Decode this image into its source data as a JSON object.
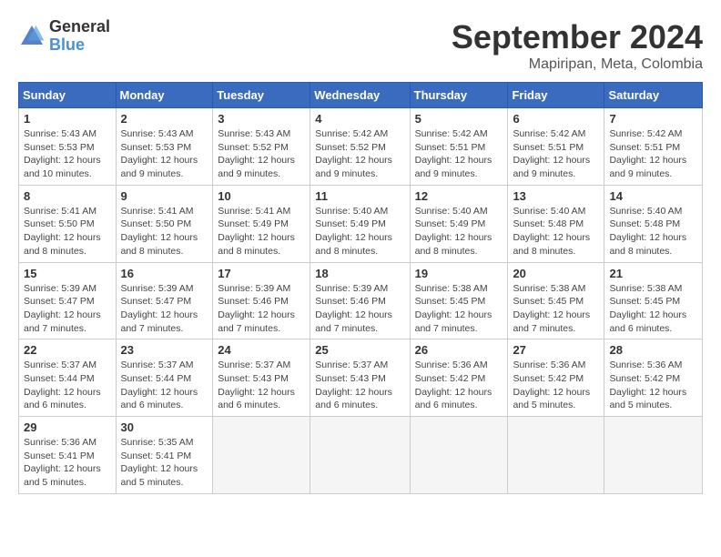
{
  "logo": {
    "text1": "General",
    "text2": "Blue"
  },
  "title": {
    "month_year": "September 2024",
    "location": "Mapiripan, Meta, Colombia"
  },
  "days_of_week": [
    "Sunday",
    "Monday",
    "Tuesday",
    "Wednesday",
    "Thursday",
    "Friday",
    "Saturday"
  ],
  "weeks": [
    [
      {
        "day": "1",
        "sunrise": "5:43 AM",
        "sunset": "5:53 PM",
        "daylight": "12 hours and 10 minutes."
      },
      {
        "day": "2",
        "sunrise": "5:43 AM",
        "sunset": "5:53 PM",
        "daylight": "12 hours and 9 minutes."
      },
      {
        "day": "3",
        "sunrise": "5:43 AM",
        "sunset": "5:52 PM",
        "daylight": "12 hours and 9 minutes."
      },
      {
        "day": "4",
        "sunrise": "5:42 AM",
        "sunset": "5:52 PM",
        "daylight": "12 hours and 9 minutes."
      },
      {
        "day": "5",
        "sunrise": "5:42 AM",
        "sunset": "5:51 PM",
        "daylight": "12 hours and 9 minutes."
      },
      {
        "day": "6",
        "sunrise": "5:42 AM",
        "sunset": "5:51 PM",
        "daylight": "12 hours and 9 minutes."
      },
      {
        "day": "7",
        "sunrise": "5:42 AM",
        "sunset": "5:51 PM",
        "daylight": "12 hours and 9 minutes."
      }
    ],
    [
      {
        "day": "8",
        "sunrise": "5:41 AM",
        "sunset": "5:50 PM",
        "daylight": "12 hours and 8 minutes."
      },
      {
        "day": "9",
        "sunrise": "5:41 AM",
        "sunset": "5:50 PM",
        "daylight": "12 hours and 8 minutes."
      },
      {
        "day": "10",
        "sunrise": "5:41 AM",
        "sunset": "5:49 PM",
        "daylight": "12 hours and 8 minutes."
      },
      {
        "day": "11",
        "sunrise": "5:40 AM",
        "sunset": "5:49 PM",
        "daylight": "12 hours and 8 minutes."
      },
      {
        "day": "12",
        "sunrise": "5:40 AM",
        "sunset": "5:49 PM",
        "daylight": "12 hours and 8 minutes."
      },
      {
        "day": "13",
        "sunrise": "5:40 AM",
        "sunset": "5:48 PM",
        "daylight": "12 hours and 8 minutes."
      },
      {
        "day": "14",
        "sunrise": "5:40 AM",
        "sunset": "5:48 PM",
        "daylight": "12 hours and 8 minutes."
      }
    ],
    [
      {
        "day": "15",
        "sunrise": "5:39 AM",
        "sunset": "5:47 PM",
        "daylight": "12 hours and 7 minutes."
      },
      {
        "day": "16",
        "sunrise": "5:39 AM",
        "sunset": "5:47 PM",
        "daylight": "12 hours and 7 minutes."
      },
      {
        "day": "17",
        "sunrise": "5:39 AM",
        "sunset": "5:46 PM",
        "daylight": "12 hours and 7 minutes."
      },
      {
        "day": "18",
        "sunrise": "5:39 AM",
        "sunset": "5:46 PM",
        "daylight": "12 hours and 7 minutes."
      },
      {
        "day": "19",
        "sunrise": "5:38 AM",
        "sunset": "5:45 PM",
        "daylight": "12 hours and 7 minutes."
      },
      {
        "day": "20",
        "sunrise": "5:38 AM",
        "sunset": "5:45 PM",
        "daylight": "12 hours and 7 minutes."
      },
      {
        "day": "21",
        "sunrise": "5:38 AM",
        "sunset": "5:45 PM",
        "daylight": "12 hours and 6 minutes."
      }
    ],
    [
      {
        "day": "22",
        "sunrise": "5:37 AM",
        "sunset": "5:44 PM",
        "daylight": "12 hours and 6 minutes."
      },
      {
        "day": "23",
        "sunrise": "5:37 AM",
        "sunset": "5:44 PM",
        "daylight": "12 hours and 6 minutes."
      },
      {
        "day": "24",
        "sunrise": "5:37 AM",
        "sunset": "5:43 PM",
        "daylight": "12 hours and 6 minutes."
      },
      {
        "day": "25",
        "sunrise": "5:37 AM",
        "sunset": "5:43 PM",
        "daylight": "12 hours and 6 minutes."
      },
      {
        "day": "26",
        "sunrise": "5:36 AM",
        "sunset": "5:42 PM",
        "daylight": "12 hours and 6 minutes."
      },
      {
        "day": "27",
        "sunrise": "5:36 AM",
        "sunset": "5:42 PM",
        "daylight": "12 hours and 5 minutes."
      },
      {
        "day": "28",
        "sunrise": "5:36 AM",
        "sunset": "5:42 PM",
        "daylight": "12 hours and 5 minutes."
      }
    ],
    [
      {
        "day": "29",
        "sunrise": "5:36 AM",
        "sunset": "5:41 PM",
        "daylight": "12 hours and 5 minutes."
      },
      {
        "day": "30",
        "sunrise": "5:35 AM",
        "sunset": "5:41 PM",
        "daylight": "12 hours and 5 minutes."
      },
      null,
      null,
      null,
      null,
      null
    ]
  ],
  "labels": {
    "sunrise": "Sunrise:",
    "sunset": "Sunset:",
    "daylight": "Daylight:"
  }
}
